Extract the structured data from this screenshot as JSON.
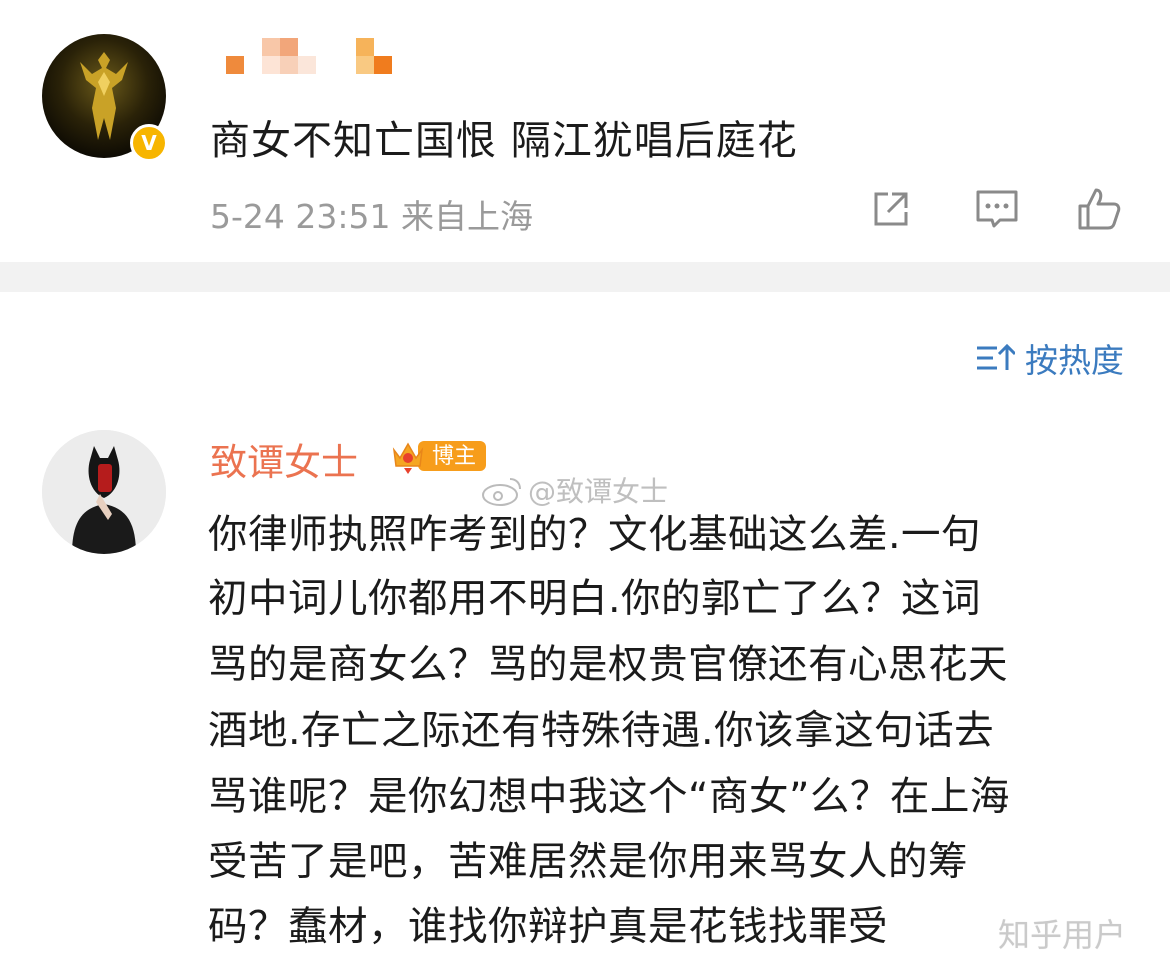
{
  "post": {
    "text": "商女不知亡国恨 隔江犹唱后庭花",
    "meta": "5-24 23:51 来自上海",
    "verified_badge": "V",
    "icons": [
      "share-icon",
      "comment-icon",
      "like-icon"
    ]
  },
  "comments": {
    "sort_label": "按热度",
    "sort_icon": "sort-icon",
    "first": {
      "author": "致谭女士",
      "badge_label": "博主",
      "lines": [
        "你律师执照咋考到的？文化基础这么差.一句",
        "初中词儿你都用不明白.你的郭亡了么？这词",
        "骂的是商女么？骂的是权贵官僚还有心思花天",
        "酒地.存亡之际还有特殊待遇.你该拿这句话去",
        "骂谁呢？是你幻想中我这个“商女”么？在上海",
        "受苦了是吧，苦难居然是你用来骂女人的筹",
        "码？蠢材，谁找你辩护真是花钱找罪受"
      ]
    }
  },
  "watermarks": {
    "weibo": "@致谭女士",
    "zhihu": "知乎用户"
  },
  "colors": {
    "author": "#eb7350",
    "sort": "#3b7bbf",
    "meta": "#9a9a9a",
    "badge": "#f79d1b",
    "verified": "#f7b500"
  }
}
